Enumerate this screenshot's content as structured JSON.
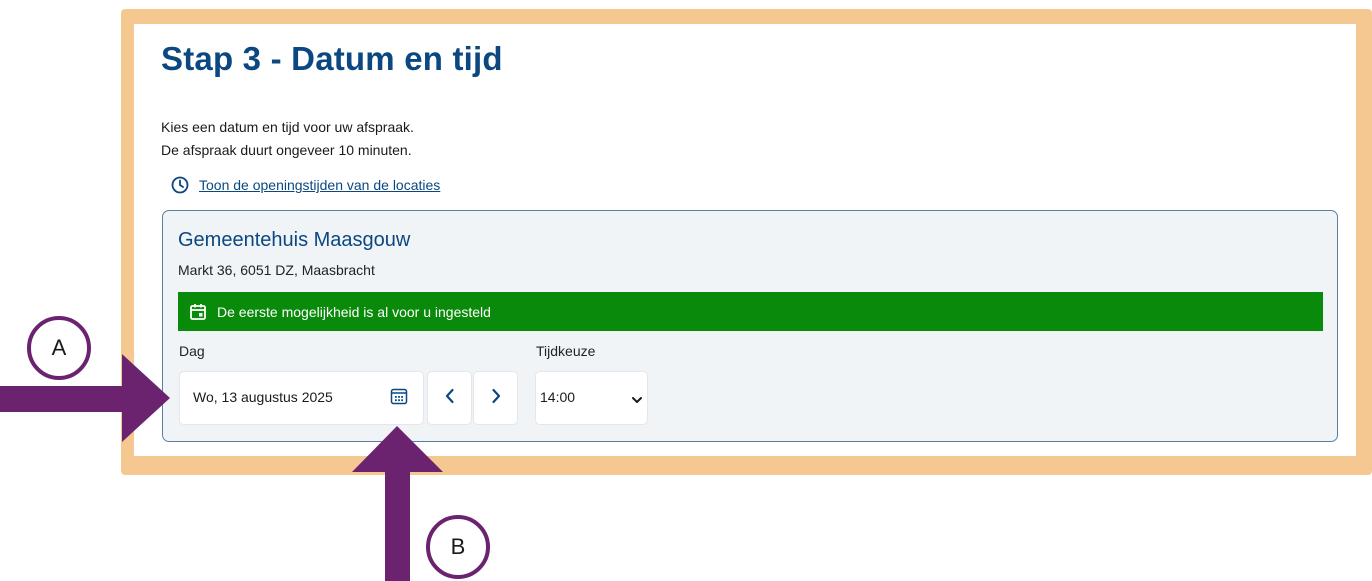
{
  "step": {
    "title": "Stap 3 - Datum en tijd",
    "intro_line_1": "Kies een datum en tijd voor uw afspraak.",
    "intro_line_2": "De afspraak duurt ongeveer 10 minuten.",
    "hours_link": "Toon de openingstijden van de locaties"
  },
  "location": {
    "name": "Gemeentehuis Maasgouw",
    "address": "Markt 36, 6051 DZ, Maasbracht",
    "notice": "De eerste mogelijkheid is al voor u ingesteld"
  },
  "form": {
    "day_label": "Dag",
    "day_value": "Wo, 13 augustus 2025",
    "time_label": "Tijdkeuze",
    "time_value": "14:00"
  },
  "annotations": {
    "marker_a": "A",
    "marker_b": "B"
  },
  "colors": {
    "frame": "#f5c892",
    "title": "#0b4780",
    "success": "#0a8a0a",
    "arrow": "#6b2370",
    "card_bg": "#f1f4f7",
    "card_border": "#5d7fa6"
  },
  "icons": {
    "hours": "clock-icon",
    "notice": "calendar-icon",
    "picker": "calendar-grid-icon",
    "prev": "chevron-left-icon",
    "next": "chevron-right-icon",
    "select": "chevron-down-icon"
  }
}
